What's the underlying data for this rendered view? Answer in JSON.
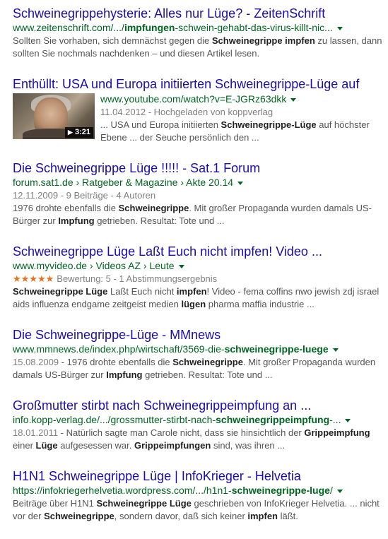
{
  "results": [
    {
      "title": "Schweinegrippehysterie: Alles nur Lüge? - ZeitenSchrift",
      "url_pre": "www.zeitenschrift.com/.../",
      "url_bold": "impfungen",
      "url_post": "-schwein-gehabt-das-virus-killt-nic...",
      "snippet_html": "Sollten Sie vorhaben, sich demnächst gegen die <b>Schweinegrippe impfen</b> zu lassen, dann sollten Sie nochmals nachdenken – und diesen Artikel lesen."
    },
    {
      "title": "Enthüllt: USA und Europa initiierten Schweinegrippe-Lüge auf",
      "url_pre": "www.youtube.com/watch?v=E-JGRz63dkk",
      "url_bold": "",
      "url_post": "",
      "date_line": "11.04.2012 - Hochgeladen von koppverlag",
      "thumb_duration": "3:21",
      "snippet_html": "... USA und Europa initiierten <b>Schweinegrippe-Lüge</b> auf höchster Ebene ... der Seuche persönlich den ..."
    },
    {
      "title": "Die Schweinegrippe Lüge !!!!! - Sat.1 Forum",
      "url_pre": "forum.sat1.de › Ratgeber & Magazine › Akte 20.14",
      "url_bold": "",
      "url_post": "",
      "meta": "12.11.2009 - 9 Beiträge - 4 Autoren",
      "snippet_html": "1976 drohte ebenfalls die <b>Schweinegrippe</b>. Mit großer Propaganda wurden damals US-Bürger zur <b>Impfung</b> getrieben. Resultat: Tote und ..."
    },
    {
      "title": "Schweinegrippe Lüge Laßt Euch nicht impfen! Video ...",
      "url_pre": "www.myvideo.de › Videos AZ › Leute",
      "url_bold": "",
      "url_post": "",
      "stars": "★★★★★",
      "rating_text": "Bewertung: 5 - 1 Abstimmungsergebnis",
      "snippet_html": "<b>Schweinegrippe Lüge</b> Laßt Euch nicht <b>impfen</b>! Video - fema coffins nwo jewish zdj israel aids influenza endgame zeitgeist medien <b>lügen</b> pharma maffia industrie ..."
    },
    {
      "title": "Die Schweinegrippe-Lüge - MMnews",
      "url_pre": "www.mmnews.de/index.php/wirtschaft/3569-die-",
      "url_bold": "schweinegrippe-luege",
      "url_post": "",
      "date": "15.08.2009",
      "snippet_html": " - 1976 drohte ebenfalls die <b>Schweinegrippe</b>. Mit großer Propaganda wurden damals US-Bürger zur <b>Impfung</b> getrieben. Resultat: Tote und ..."
    },
    {
      "title": "Großmutter stirbt nach Schweinegrippeimpfung an ...",
      "url_pre": "info.kopp-verlag.de/.../grossmutter-stirbt-nach-",
      "url_bold": "schweinegrippeimpfung",
      "url_post": "-...",
      "date": "18.01.2011",
      "snippet_html": " - Natürlich sagte man Carole nicht, dass sie hinsichtlich der <b>Grippeimpfung</b> einer <b>Lüge</b> aufgesessen war. <b>Grippeimpfungen</b> sind, was ihren ..."
    },
    {
      "title": "H1N1 Schweinegrippe Lüge | InfoKrieger - Helvetia",
      "url_pre": "https://infokriegerhelvetia.wordpress.com/.../h1n1-",
      "url_bold": "schweinegrippe-luge",
      "url_post": "/",
      "snippet_html": "Beiträge über H1N1 <b>Schweinegrippe Lüge</b> geschrieben von InfoKrieger Helvetia. ... nicht vor der <b>Schweinegrippe</b>, sondern davor, daß sich keiner <b>impfen</b> läßt."
    }
  ]
}
